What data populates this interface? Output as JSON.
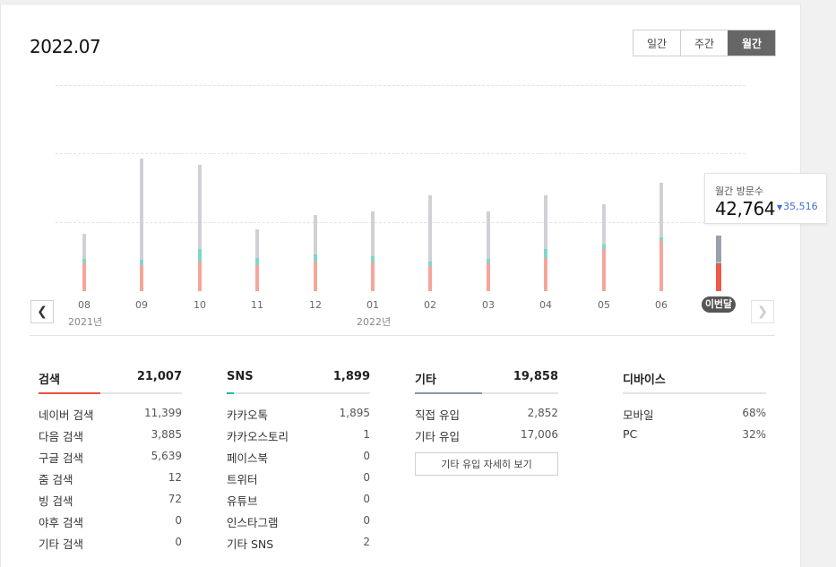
{
  "header": {
    "title": "2022.07"
  },
  "period_tabs": [
    {
      "label": "일간",
      "active": false
    },
    {
      "label": "주간",
      "active": false
    },
    {
      "label": "월간",
      "active": true
    }
  ],
  "colors": {
    "search": "#f6a59a",
    "search_current": "#ee5a48",
    "sns": "#7fd6cc",
    "other": "#cfd1d5",
    "other_current": "#9aa1ac",
    "search_tab_accent": "#e8533f",
    "sns_tab_accent": "#25b8a9",
    "other_tab_accent": "#8a96a8"
  },
  "chart_data": {
    "type": "bar",
    "stacked": true,
    "categories": [
      "08",
      "09",
      "10",
      "11",
      "12",
      "01",
      "02",
      "03",
      "04",
      "05",
      "06",
      "이번달"
    ],
    "year_labels": [
      {
        "label": "2021년",
        "category": "08"
      },
      {
        "label": "2022년",
        "category": "01"
      }
    ],
    "series": [
      {
        "key": "search",
        "values": [
          31000,
          29000,
          33000,
          29000,
          33000,
          32000,
          28000,
          31000,
          37000,
          47000,
          56000,
          31000
        ]
      },
      {
        "key": "sns",
        "values": [
          5000,
          6000,
          14000,
          8000,
          8000,
          7000,
          5000,
          5000,
          10000,
          5000,
          4000,
          2000
        ]
      },
      {
        "key": "other",
        "values": [
          28000,
          113000,
          94000,
          32000,
          44000,
          50000,
          74000,
          53000,
          60000,
          45000,
          61000,
          29000
        ]
      }
    ],
    "grid": true,
    "ylim": [
      0,
      230000
    ]
  },
  "tooltip": {
    "label": "월간 방문수",
    "value": "42,764",
    "prev_value": "35,516"
  },
  "stats": {
    "search": {
      "name": "검색",
      "total": "21,007",
      "share": 0.43,
      "rows": [
        {
          "label": "네이버 검색",
          "value": "11,399"
        },
        {
          "label": "다음 검색",
          "value": "3,885"
        },
        {
          "label": "구글 검색",
          "value": "5,639"
        },
        {
          "label": "줌 검색",
          "value": "12"
        },
        {
          "label": "빙 검색",
          "value": "72"
        },
        {
          "label": "야후 검색",
          "value": "0"
        },
        {
          "label": "기타 검색",
          "value": "0"
        }
      ]
    },
    "sns": {
      "name": "SNS",
      "total": "1,899",
      "share": 0.05,
      "rows": [
        {
          "label": "카카오톡",
          "value": "1,895"
        },
        {
          "label": "카카오스토리",
          "value": "1"
        },
        {
          "label": "페이스북",
          "value": "0"
        },
        {
          "label": "트위터",
          "value": "0"
        },
        {
          "label": "유튜브",
          "value": "0"
        },
        {
          "label": "인스타그램",
          "value": "0"
        },
        {
          "label": "기타 SNS",
          "value": "2"
        }
      ]
    },
    "other": {
      "name": "기타",
      "total": "19,858",
      "share": 0.47,
      "rows": [
        {
          "label": "직접 유입",
          "value": "2,852"
        },
        {
          "label": "기타 유입",
          "value": "17,006"
        }
      ],
      "detail_button": "기타 유입 자세히 보기"
    },
    "device": {
      "name": "디바이스",
      "rows": [
        {
          "label": "모바일",
          "value": "68%"
        },
        {
          "label": "PC",
          "value": "32%"
        }
      ]
    }
  }
}
